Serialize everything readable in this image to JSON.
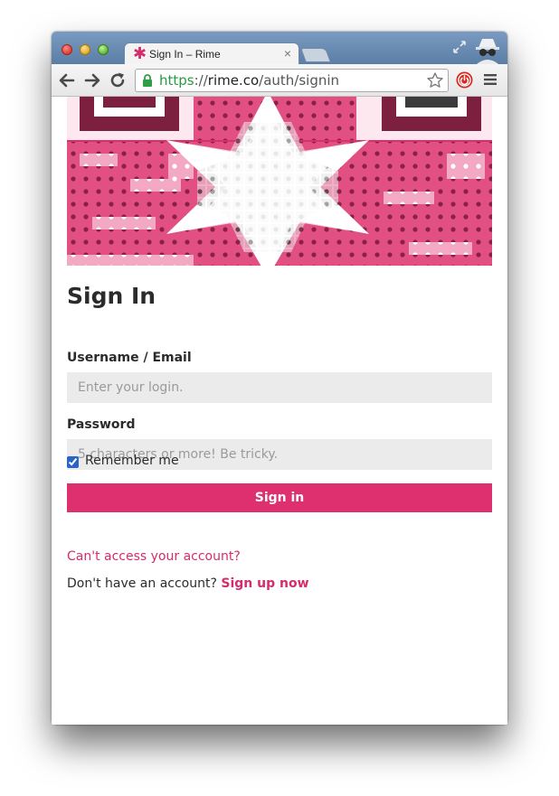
{
  "browser": {
    "tab_title": "Sign In – Rime",
    "tab_close": "×",
    "url_scheme": "https",
    "url_separator": "://",
    "url_host": "rime.co",
    "url_path": "/auth/signin",
    "icons": {
      "back": "back-arrow-icon",
      "forward": "forward-arrow-icon",
      "reload": "reload-icon",
      "lock": "lock-icon",
      "bookmark": "star-icon",
      "extension": "power-icon",
      "menu": "hamburger-menu-icon",
      "incognito": "incognito-icon",
      "fullscreen": "fullscreen-restore-icon"
    }
  },
  "form": {
    "title": "Sign In",
    "username_label": "Username / Email",
    "username_placeholder": "Enter your login.",
    "username_value": "",
    "password_label": "Password",
    "password_placeholder": "5 characters or more! Be tricky.",
    "password_value": "",
    "remember_label": "Remember me",
    "remember_checked": true,
    "submit_label": "Sign in"
  },
  "links": {
    "forgot": "Can't access your account?",
    "no_account_text": "Don't have an account?",
    "signup": "Sign up now"
  },
  "colors": {
    "accent": "#de2f6e",
    "link": "#d42c6c",
    "hero_dark": "#7d1f3f",
    "hero_light": "#f3a9c3",
    "input_bg": "#ebebeb"
  }
}
